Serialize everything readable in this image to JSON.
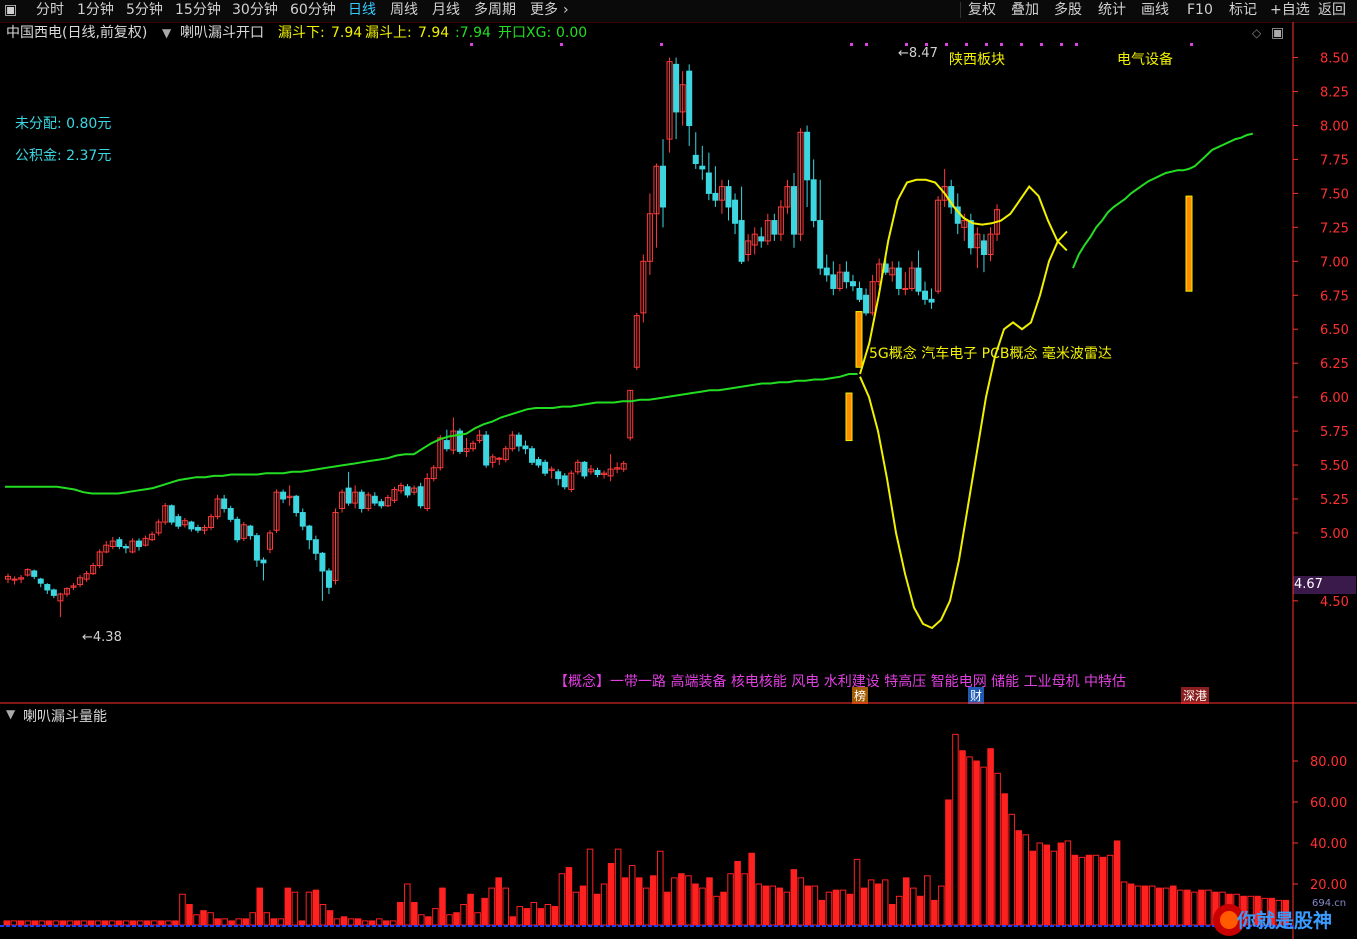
{
  "toolbar": {
    "left": [
      "分时",
      "1分钟",
      "5分钟",
      "15分钟",
      "30分钟",
      "60分钟",
      "日线",
      "周线",
      "月线",
      "多周期",
      "更多"
    ],
    "active": "日线",
    "right": [
      "复权",
      "叠加",
      "多股",
      "统计",
      "画线",
      "F10",
      "标记",
      "+自选",
      "返回"
    ]
  },
  "header": {
    "stock": "中国西电(日线,前复权)",
    "indicator": "喇叭漏斗开口",
    "funnel_low_label": "漏斗下:",
    "funnel_low": "7.94",
    "funnel_up_label": "漏斗上:",
    "funnel_up": "7.94",
    "mid_value": ":7.94",
    "open_label": "开口XG:",
    "open_value": "0.00"
  },
  "notes": {
    "undistributed": "未分配: 0.80元",
    "reserve": "公积金: 2.37元",
    "block1": "陕西板块",
    "block2": "电气设备",
    "concepts_mid": "5G概念 汽车电子 PCB概念 毫米波雷达",
    "concepts_bottom": "【概念】一带一路 高端装备 核电核能 风电 水利建设 特高压 智能电网 储能 工业母机 中特估",
    "tag_list": "榜",
    "tag_fin": "财",
    "tag_hk": "深港",
    "high_mark": "8.47",
    "low_mark": "4.38",
    "price_tag": "4.67"
  },
  "sub": {
    "title": "喇叭漏斗量能"
  },
  "watermark": {
    "text": "你就是股神",
    "site": "694.cn"
  },
  "colors": {
    "up": "#ff3b3b",
    "down": "#3cd6e0",
    "green_line": "#22dd22",
    "yellow_line": "#f0f000",
    "axis": "#ff3030",
    "magenta": "#e040e0"
  },
  "chart_data": {
    "type": "candlestick",
    "ylim": [
      4.3,
      8.6
    ],
    "y_ticks": [
      "8.50",
      "8.25",
      "8.00",
      "7.75",
      "7.50",
      "7.25",
      "7.00",
      "6.75",
      "6.50",
      "6.25",
      "6.00",
      "5.75",
      "5.50",
      "5.25",
      "5.00",
      "4.50"
    ],
    "candles": [
      [
        4.66,
        4.68,
        4.63,
        4.7
      ],
      [
        4.66,
        4.66,
        4.62,
        4.68
      ],
      [
        4.66,
        4.67,
        4.63,
        4.69
      ],
      [
        4.69,
        4.73,
        4.68,
        4.74
      ],
      [
        4.72,
        4.68,
        4.66,
        4.73
      ],
      [
        4.66,
        4.63,
        4.6,
        4.67
      ],
      [
        4.62,
        4.58,
        4.55,
        4.63
      ],
      [
        4.58,
        4.54,
        4.52,
        4.59
      ],
      [
        4.5,
        4.55,
        4.38,
        4.56
      ],
      [
        4.55,
        4.59,
        4.53,
        4.6
      ],
      [
        4.6,
        4.61,
        4.58,
        4.63
      ],
      [
        4.62,
        4.67,
        4.6,
        4.69
      ],
      [
        4.66,
        4.7,
        4.64,
        4.72
      ],
      [
        4.7,
        4.76,
        4.69,
        4.78
      ],
      [
        4.76,
        4.86,
        4.74,
        4.88
      ],
      [
        4.86,
        4.91,
        4.85,
        4.94
      ],
      [
        4.9,
        4.94,
        4.88,
        4.97
      ],
      [
        4.95,
        4.9,
        4.88,
        4.97
      ],
      [
        4.9,
        4.89,
        4.85,
        4.92
      ],
      [
        4.86,
        4.94,
        4.85,
        4.96
      ],
      [
        4.94,
        4.9,
        4.87,
        4.96
      ],
      [
        4.91,
        4.96,
        4.9,
        4.98
      ],
      [
        4.95,
        4.99,
        4.94,
        5.01
      ],
      [
        5.0,
        5.08,
        4.98,
        5.1
      ],
      [
        5.08,
        5.2,
        5.06,
        5.22
      ],
      [
        5.2,
        5.08,
        5.06,
        5.21
      ],
      [
        5.12,
        5.05,
        5.03,
        5.14
      ],
      [
        5.06,
        5.09,
        5.04,
        5.11
      ],
      [
        5.08,
        5.03,
        5.01,
        5.09
      ],
      [
        5.04,
        5.02,
        5.0,
        5.06
      ],
      [
        5.02,
        5.04,
        4.99,
        5.06
      ],
      [
        5.04,
        5.12,
        5.02,
        5.14
      ],
      [
        5.12,
        5.25,
        5.1,
        5.28
      ],
      [
        5.25,
        5.18,
        5.15,
        5.28
      ],
      [
        5.18,
        5.1,
        5.08,
        5.2
      ],
      [
        5.1,
        4.95,
        4.93,
        5.12
      ],
      [
        4.96,
        5.06,
        4.94,
        5.08
      ],
      [
        5.05,
        4.98,
        4.95,
        5.06
      ],
      [
        4.98,
        4.8,
        4.75,
        5.0
      ],
      [
        4.8,
        4.78,
        4.65,
        4.82
      ],
      [
        4.88,
        5.0,
        4.85,
        5.02
      ],
      [
        5.02,
        5.3,
        5.0,
        5.32
      ],
      [
        5.3,
        5.25,
        5.22,
        5.32
      ],
      [
        5.26,
        5.27,
        5.2,
        5.35
      ],
      [
        5.27,
        5.15,
        5.12,
        5.28
      ],
      [
        5.15,
        5.05,
        5.02,
        5.18
      ],
      [
        5.05,
        4.95,
        4.88,
        5.06
      ],
      [
        4.95,
        4.85,
        4.8,
        4.98
      ],
      [
        4.85,
        4.72,
        4.5,
        4.86
      ],
      [
        4.72,
        4.6,
        4.55,
        4.74
      ],
      [
        4.65,
        5.15,
        4.62,
        5.18
      ],
      [
        5.18,
        5.3,
        5.15,
        5.32
      ],
      [
        5.33,
        5.22,
        5.2,
        5.45
      ],
      [
        5.22,
        5.3,
        5.18,
        5.35
      ],
      [
        5.3,
        5.18,
        5.15,
        5.32
      ],
      [
        5.18,
        5.28,
        5.16,
        5.3
      ],
      [
        5.27,
        5.22,
        5.2,
        5.3
      ],
      [
        5.23,
        5.2,
        5.18,
        5.25
      ],
      [
        5.2,
        5.26,
        5.19,
        5.28
      ],
      [
        5.24,
        5.32,
        5.22,
        5.34
      ],
      [
        5.31,
        5.35,
        5.29,
        5.37
      ],
      [
        5.34,
        5.28,
        5.26,
        5.36
      ],
      [
        5.3,
        5.33,
        5.28,
        5.35
      ],
      [
        5.34,
        5.2,
        5.18,
        5.37
      ],
      [
        5.18,
        5.4,
        5.16,
        5.44
      ],
      [
        5.4,
        5.48,
        5.38,
        5.5
      ],
      [
        5.48,
        5.7,
        5.46,
        5.72
      ],
      [
        5.68,
        5.62,
        5.6,
        5.76
      ],
      [
        5.61,
        5.75,
        5.58,
        5.85
      ],
      [
        5.75,
        5.6,
        5.58,
        5.77
      ],
      [
        5.6,
        5.62,
        5.56,
        5.7
      ],
      [
        5.62,
        5.66,
        5.6,
        5.68
      ],
      [
        5.68,
        5.72,
        5.66,
        5.76
      ],
      [
        5.72,
        5.5,
        5.48,
        5.75
      ],
      [
        5.52,
        5.56,
        5.48,
        5.58
      ],
      [
        5.55,
        5.55,
        5.5,
        5.56
      ],
      [
        5.54,
        5.62,
        5.52,
        5.64
      ],
      [
        5.62,
        5.72,
        5.6,
        5.75
      ],
      [
        5.72,
        5.64,
        5.6,
        5.74
      ],
      [
        5.64,
        5.62,
        5.58,
        5.68
      ],
      [
        5.62,
        5.52,
        5.5,
        5.64
      ],
      [
        5.54,
        5.5,
        5.48,
        5.56
      ],
      [
        5.52,
        5.44,
        5.42,
        5.54
      ],
      [
        5.46,
        5.47,
        5.4,
        5.49
      ],
      [
        5.45,
        5.4,
        5.35,
        5.47
      ],
      [
        5.42,
        5.34,
        5.32,
        5.44
      ],
      [
        5.32,
        5.44,
        5.3,
        5.46
      ],
      [
        5.45,
        5.52,
        5.43,
        5.54
      ],
      [
        5.52,
        5.42,
        5.4,
        5.53
      ],
      [
        5.45,
        5.47,
        5.43,
        5.5
      ],
      [
        5.46,
        5.43,
        5.41,
        5.48
      ],
      [
        5.43,
        5.44,
        5.4,
        5.46
      ],
      [
        5.42,
        5.47,
        5.38,
        5.58
      ],
      [
        5.47,
        5.48,
        5.44,
        5.52
      ],
      [
        5.47,
        5.51,
        5.45,
        5.53
      ],
      [
        5.7,
        6.05,
        5.68,
        6.05
      ],
      [
        6.22,
        6.6,
        6.2,
        6.62
      ],
      [
        6.62,
        7.0,
        6.55,
        7.05
      ],
      [
        7.0,
        7.35,
        6.9,
        7.5
      ],
      [
        7.35,
        7.7,
        7.1,
        7.72
      ],
      [
        7.7,
        7.4,
        7.25,
        7.9
      ],
      [
        7.9,
        8.47,
        7.8,
        8.5
      ],
      [
        8.45,
        8.1,
        7.9,
        8.5
      ],
      [
        8.1,
        8.3,
        8.0,
        8.4
      ],
      [
        8.4,
        8.0,
        7.85,
        8.45
      ],
      [
        7.78,
        7.72,
        7.68,
        7.95
      ],
      [
        7.7,
        7.68,
        7.6,
        7.85
      ],
      [
        7.65,
        7.5,
        7.45,
        7.8
      ],
      [
        7.5,
        7.45,
        7.4,
        7.7
      ],
      [
        7.45,
        7.55,
        7.35,
        7.6
      ],
      [
        7.55,
        7.4,
        7.3,
        7.6
      ],
      [
        7.45,
        7.28,
        7.2,
        7.5
      ],
      [
        7.3,
        7.0,
        6.98,
        7.55
      ],
      [
        7.05,
        7.15,
        7.0,
        7.2
      ],
      [
        7.12,
        7.2,
        7.05,
        7.25
      ],
      [
        7.18,
        7.15,
        7.1,
        7.25
      ],
      [
        7.15,
        7.3,
        7.12,
        7.35
      ],
      [
        7.3,
        7.2,
        7.15,
        7.35
      ],
      [
        7.2,
        7.4,
        7.15,
        7.45
      ],
      [
        7.4,
        7.55,
        7.35,
        7.6
      ],
      [
        7.55,
        7.2,
        7.1,
        7.65
      ],
      [
        7.2,
        7.95,
        7.15,
        7.98
      ],
      [
        7.95,
        7.6,
        7.4,
        8.0
      ],
      [
        7.6,
        7.3,
        7.25,
        7.75
      ],
      [
        7.3,
        6.95,
        6.9,
        7.6
      ],
      [
        6.95,
        6.9,
        6.85,
        7.05
      ],
      [
        6.9,
        6.8,
        6.75,
        7.0
      ],
      [
        6.8,
        6.92,
        6.78,
        6.98
      ],
      [
        6.92,
        6.85,
        6.8,
        7.0
      ],
      [
        6.85,
        6.82,
        6.78,
        6.9
      ],
      [
        6.8,
        6.72,
        6.7,
        6.85
      ],
      [
        6.75,
        6.62,
        6.6,
        6.8
      ],
      [
        6.62,
        6.85,
        6.6,
        6.9
      ],
      [
        6.85,
        6.98,
        6.82,
        7.02
      ],
      [
        6.98,
        6.92,
        6.9,
        7.05
      ],
      [
        6.9,
        6.95,
        6.85,
        7.0
      ],
      [
        6.95,
        6.8,
        6.75,
        7.0
      ],
      [
        6.8,
        6.8,
        6.75,
        6.92
      ],
      [
        6.8,
        6.95,
        6.78,
        7.0
      ],
      [
        6.95,
        6.78,
        6.75,
        7.08
      ],
      [
        6.78,
        6.72,
        6.68,
        6.85
      ],
      [
        6.72,
        6.7,
        6.65,
        6.8
      ],
      [
        6.78,
        7.45,
        6.76,
        7.48
      ],
      [
        7.45,
        7.55,
        7.4,
        7.68
      ],
      [
        7.55,
        7.4,
        7.35,
        7.6
      ],
      [
        7.4,
        7.28,
        7.2,
        7.5
      ],
      [
        7.25,
        7.3,
        7.15,
        7.35
      ],
      [
        7.3,
        7.1,
        7.05,
        7.35
      ],
      [
        7.1,
        7.2,
        6.95,
        7.25
      ],
      [
        7.15,
        7.05,
        6.92,
        7.2
      ],
      [
        7.05,
        7.2,
        7.0,
        7.25
      ],
      [
        7.2,
        7.38,
        7.15,
        7.42
      ]
    ],
    "green_line": [
      5.34,
      5.34,
      5.34,
      5.34,
      5.34,
      5.34,
      5.34,
      5.33,
      5.32,
      5.3,
      5.29,
      5.29,
      5.29,
      5.29,
      5.3,
      5.31,
      5.32,
      5.33,
      5.35,
      5.37,
      5.39,
      5.4,
      5.41,
      5.41,
      5.42,
      5.42,
      5.43,
      5.43,
      5.43,
      5.43,
      5.44,
      5.44,
      5.44,
      5.45,
      5.45,
      5.46,
      5.47,
      5.48,
      5.49,
      5.5,
      5.51,
      5.52,
      5.53,
      5.54,
      5.55,
      5.57,
      5.58,
      5.58,
      5.62,
      5.66,
      5.69,
      5.71,
      5.72,
      5.73,
      5.77,
      5.8,
      5.82,
      5.85,
      5.87,
      5.89,
      5.91,
      5.92,
      5.92,
      5.92,
      5.93,
      5.93,
      5.94,
      5.95,
      5.96,
      5.96,
      5.96,
      5.97,
      5.97,
      5.98,
      5.98,
      5.99,
      6.0,
      6.01,
      6.02,
      6.03,
      6.04,
      6.05,
      6.05,
      6.06,
      6.07,
      6.08,
      6.09,
      6.1,
      6.1,
      6.11,
      6.11,
      6.12,
      6.12,
      6.13,
      6.13,
      6.14,
      6.15,
      6.17,
      6.17
    ],
    "green_line2": [
      6.95,
      7.05,
      7.12,
      7.18,
      7.25,
      7.3,
      7.36,
      7.4,
      7.43,
      7.46,
      7.5,
      7.53,
      7.56,
      7.59,
      7.61,
      7.63,
      7.65,
      7.66,
      7.67,
      7.67,
      7.68,
      7.7,
      7.74,
      7.78,
      7.82,
      7.84,
      7.86,
      7.88,
      7.9,
      7.91,
      7.93,
      7.94
    ],
    "yellow_line": [
      6.15,
      6.0,
      5.75,
      5.4,
      5.0,
      4.7,
      4.45,
      4.33,
      4.3,
      4.36,
      4.5,
      4.8,
      5.2,
      5.6,
      6.0,
      6.3,
      6.5,
      6.55,
      6.5,
      6.55,
      6.75,
      7.0,
      7.15,
      7.22
    ],
    "yellow_upper": [
      6.17,
      6.4,
      6.75,
      7.15,
      7.45,
      7.58,
      7.6,
      7.6,
      7.58,
      7.5,
      7.4,
      7.32,
      7.28,
      7.27,
      7.28,
      7.3,
      7.35,
      7.45,
      7.55,
      7.48,
      7.3,
      7.15,
      7.08
    ],
    "volume_ylim": [
      0,
      100
    ],
    "volume_ticks": [
      "80.00",
      "60.00",
      "40.00",
      "20.00"
    ],
    "volume": [
      2,
      2,
      2,
      2,
      2,
      2,
      2,
      2,
      2,
      2,
      2,
      2,
      2,
      2,
      2,
      2,
      2,
      2,
      2,
      2,
      2,
      2,
      2,
      2,
      2,
      15,
      10,
      5,
      7,
      6,
      3,
      3,
      2,
      3,
      3,
      6,
      18,
      6,
      3,
      3,
      18,
      16,
      2,
      16,
      17,
      10,
      7,
      3,
      4,
      3,
      3,
      2,
      2,
      3,
      2,
      2,
      11,
      20,
      11,
      5,
      4,
      8,
      18,
      5,
      6,
      10,
      15,
      6,
      13,
      18,
      23,
      18,
      4,
      9,
      8,
      11,
      8,
      10,
      9,
      25,
      28,
      16,
      19,
      37,
      15,
      20,
      30,
      37,
      23,
      29,
      23,
      18,
      24,
      36,
      16,
      23,
      25,
      24,
      20,
      18,
      23,
      14,
      16,
      25,
      31,
      25,
      35,
      20,
      19,
      19,
      18,
      16,
      27,
      23,
      19,
      19,
      12,
      16,
      17,
      17,
      15,
      32,
      18,
      22,
      20,
      22,
      10,
      14,
      23,
      18,
      14,
      24,
      12,
      19,
      61,
      93,
      85,
      82,
      80,
      77,
      86,
      74,
      64,
      54,
      46,
      44,
      36,
      40,
      39,
      36,
      40,
      41,
      34,
      33,
      34,
      34,
      33,
      34,
      41,
      21,
      20,
      19,
      19,
      19,
      18,
      18,
      19,
      17,
      17,
      16,
      17,
      17,
      16,
      16,
      15,
      15,
      14,
      14,
      14,
      13,
      13,
      12,
      12
    ]
  }
}
